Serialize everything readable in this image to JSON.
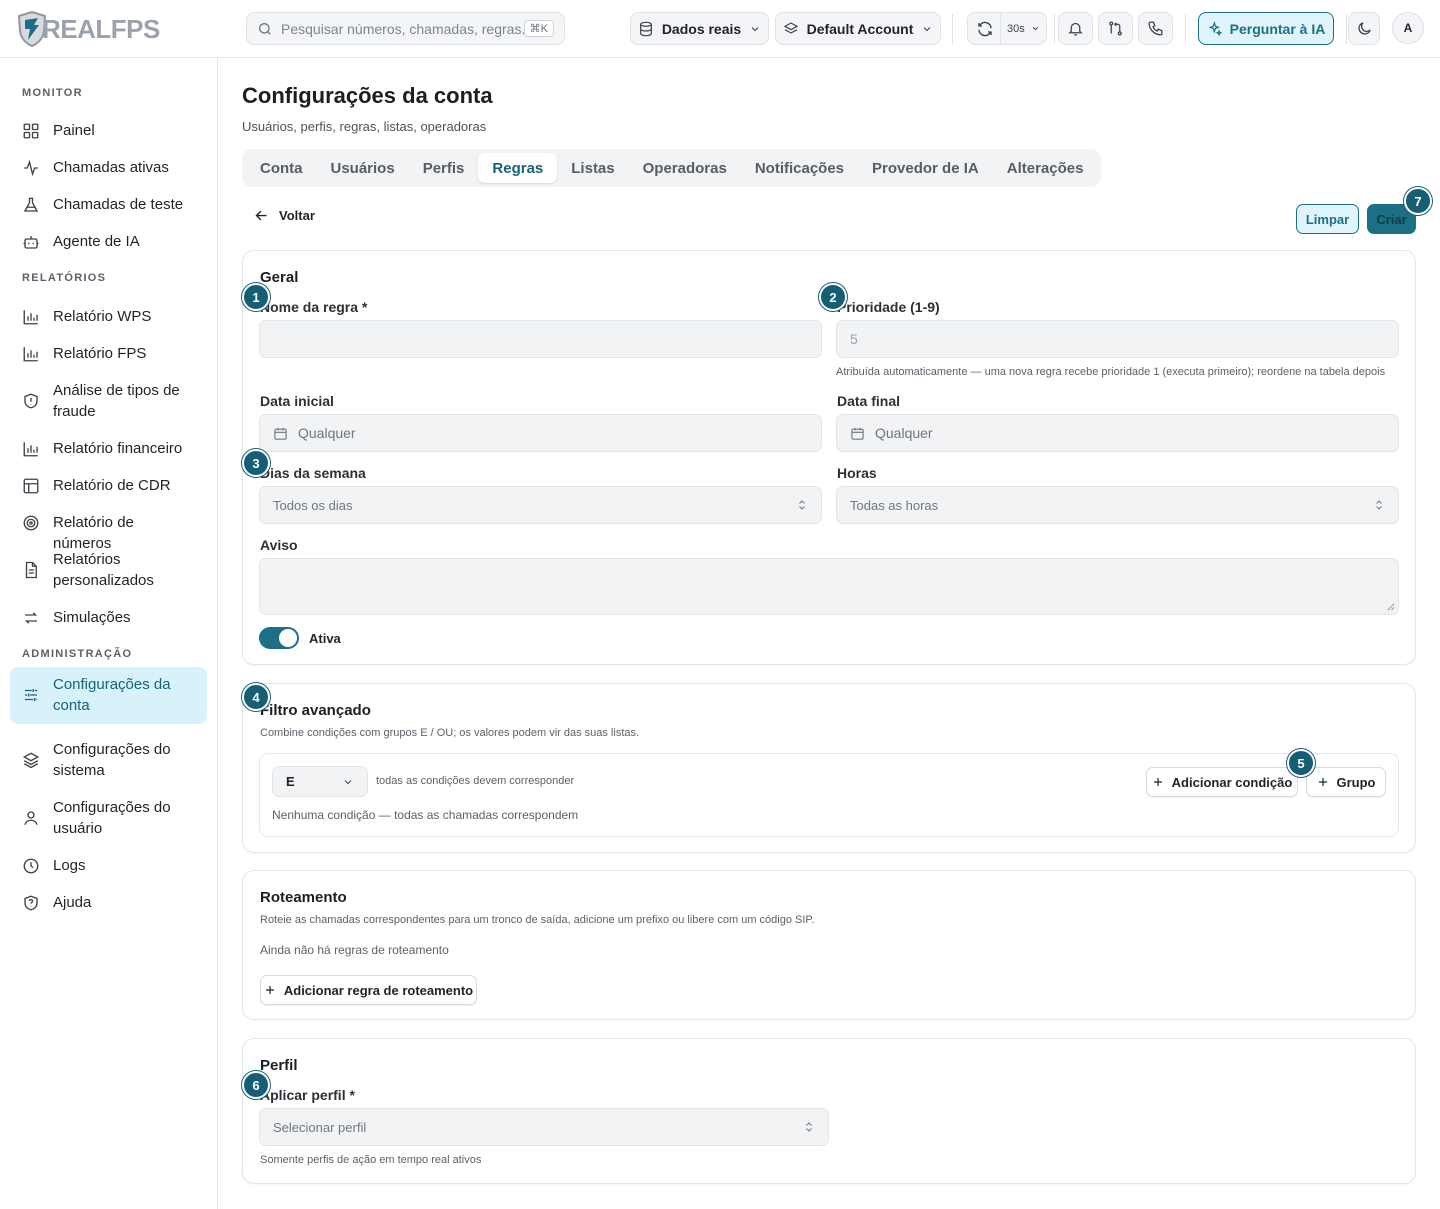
{
  "brand": {
    "name": "REALFPS"
  },
  "search": {
    "placeholder": "Pesquisar números, chamadas, regras...",
    "shortcut": "⌘K"
  },
  "topbar": {
    "data_source": "Dados reais",
    "account": "Default Account",
    "refresh_interval": "30s",
    "ask_ai": "Perguntar à IA",
    "avatar_initial": "A"
  },
  "sidebar": {
    "sections": [
      {
        "label": "MONITOR",
        "items": [
          {
            "label": "Painel",
            "icon": "grid-icon"
          },
          {
            "label": "Chamadas ativas",
            "icon": "activity-icon"
          },
          {
            "label": "Chamadas de teste",
            "icon": "flask-icon"
          },
          {
            "label": "Agente de IA",
            "icon": "bot-icon"
          }
        ]
      },
      {
        "label": "RELATÓRIOS",
        "items": [
          {
            "label": "Relatório WPS",
            "icon": "bar-chart-icon"
          },
          {
            "label": "Relatório FPS",
            "icon": "bar-chart-icon"
          },
          {
            "label": "Análise de tipos de fraude",
            "icon": "shield-icon"
          },
          {
            "label": "Relatório financeiro",
            "icon": "bar-chart-icon"
          },
          {
            "label": "Relatório de CDR",
            "icon": "table-icon"
          },
          {
            "label": "Relatório de números",
            "icon": "target-icon"
          },
          {
            "label": "Relatórios personalizados",
            "icon": "document-icon"
          },
          {
            "label": "Simulações",
            "icon": "swap-icon"
          }
        ]
      },
      {
        "label": "ADMINISTRAÇÃO",
        "items": [
          {
            "label": "Configurações da conta",
            "icon": "sliders-icon",
            "active": true
          },
          {
            "label": "Configurações do sistema",
            "icon": "layers-icon"
          },
          {
            "label": "Configurações do usuário",
            "icon": "user-icon"
          },
          {
            "label": "Logs",
            "icon": "clock-icon"
          },
          {
            "label": "Ajuda",
            "icon": "help-shield-icon"
          }
        ]
      }
    ]
  },
  "page": {
    "title": "Configurações da conta",
    "subtitle": "Usuários, perfis, regras, listas, operadoras",
    "tabs": [
      "Conta",
      "Usuários",
      "Perfis",
      "Regras",
      "Listas",
      "Operadoras",
      "Notificações",
      "Provedor de IA",
      "Alterações"
    ],
    "active_tab": "Regras",
    "back_label": "Voltar",
    "clear_label": "Limpar",
    "create_label": "Criar"
  },
  "general": {
    "title": "Geral",
    "rule_name_label": "Nome da regra *",
    "rule_name_value": "",
    "priority_label": "Prioridade (1-9)",
    "priority_value": "5",
    "priority_hint": "Atribuída automaticamente — uma nova regra recebe prioridade 1 (executa primeiro); reordene na tabela depois",
    "start_date_label": "Data inicial",
    "start_date_value": "Qualquer",
    "end_date_label": "Data final",
    "end_date_value": "Qualquer",
    "weekdays_label": "Dias da semana",
    "weekdays_value": "Todos os dias",
    "hours_label": "Horas",
    "hours_value": "Todas as horas",
    "warning_label": "Aviso",
    "warning_value": "",
    "active_label": "Ativa",
    "active": true
  },
  "filter": {
    "title": "Filtro avançado",
    "description": "Combine condições com grupos E / OU; os valores podem vir das suas listas.",
    "operator": "E",
    "operator_hint": "todas as condições devem corresponder",
    "add_condition": "Adicionar condição",
    "add_group": "Grupo",
    "empty": "Nenhuma condição — todas as chamadas correspondem"
  },
  "routing": {
    "title": "Roteamento",
    "description": "Roteie as chamadas correspondentes para um tronco de saída, adicione um prefixo ou libere com um código SIP.",
    "empty": "Ainda não há regras de roteamento",
    "add_rule": "Adicionar regra de roteamento"
  },
  "profile": {
    "title": "Perfil",
    "apply_label": "Aplicar perfil *",
    "apply_placeholder": "Selecionar perfil",
    "hint": "Somente perfis de ação em tempo real ativos"
  },
  "markers": [
    "1",
    "2",
    "3",
    "4",
    "5",
    "6",
    "7"
  ],
  "colors": {
    "accent": "#1d6f86",
    "accent_light": "#d8f2fb",
    "badge": "#155e73"
  }
}
